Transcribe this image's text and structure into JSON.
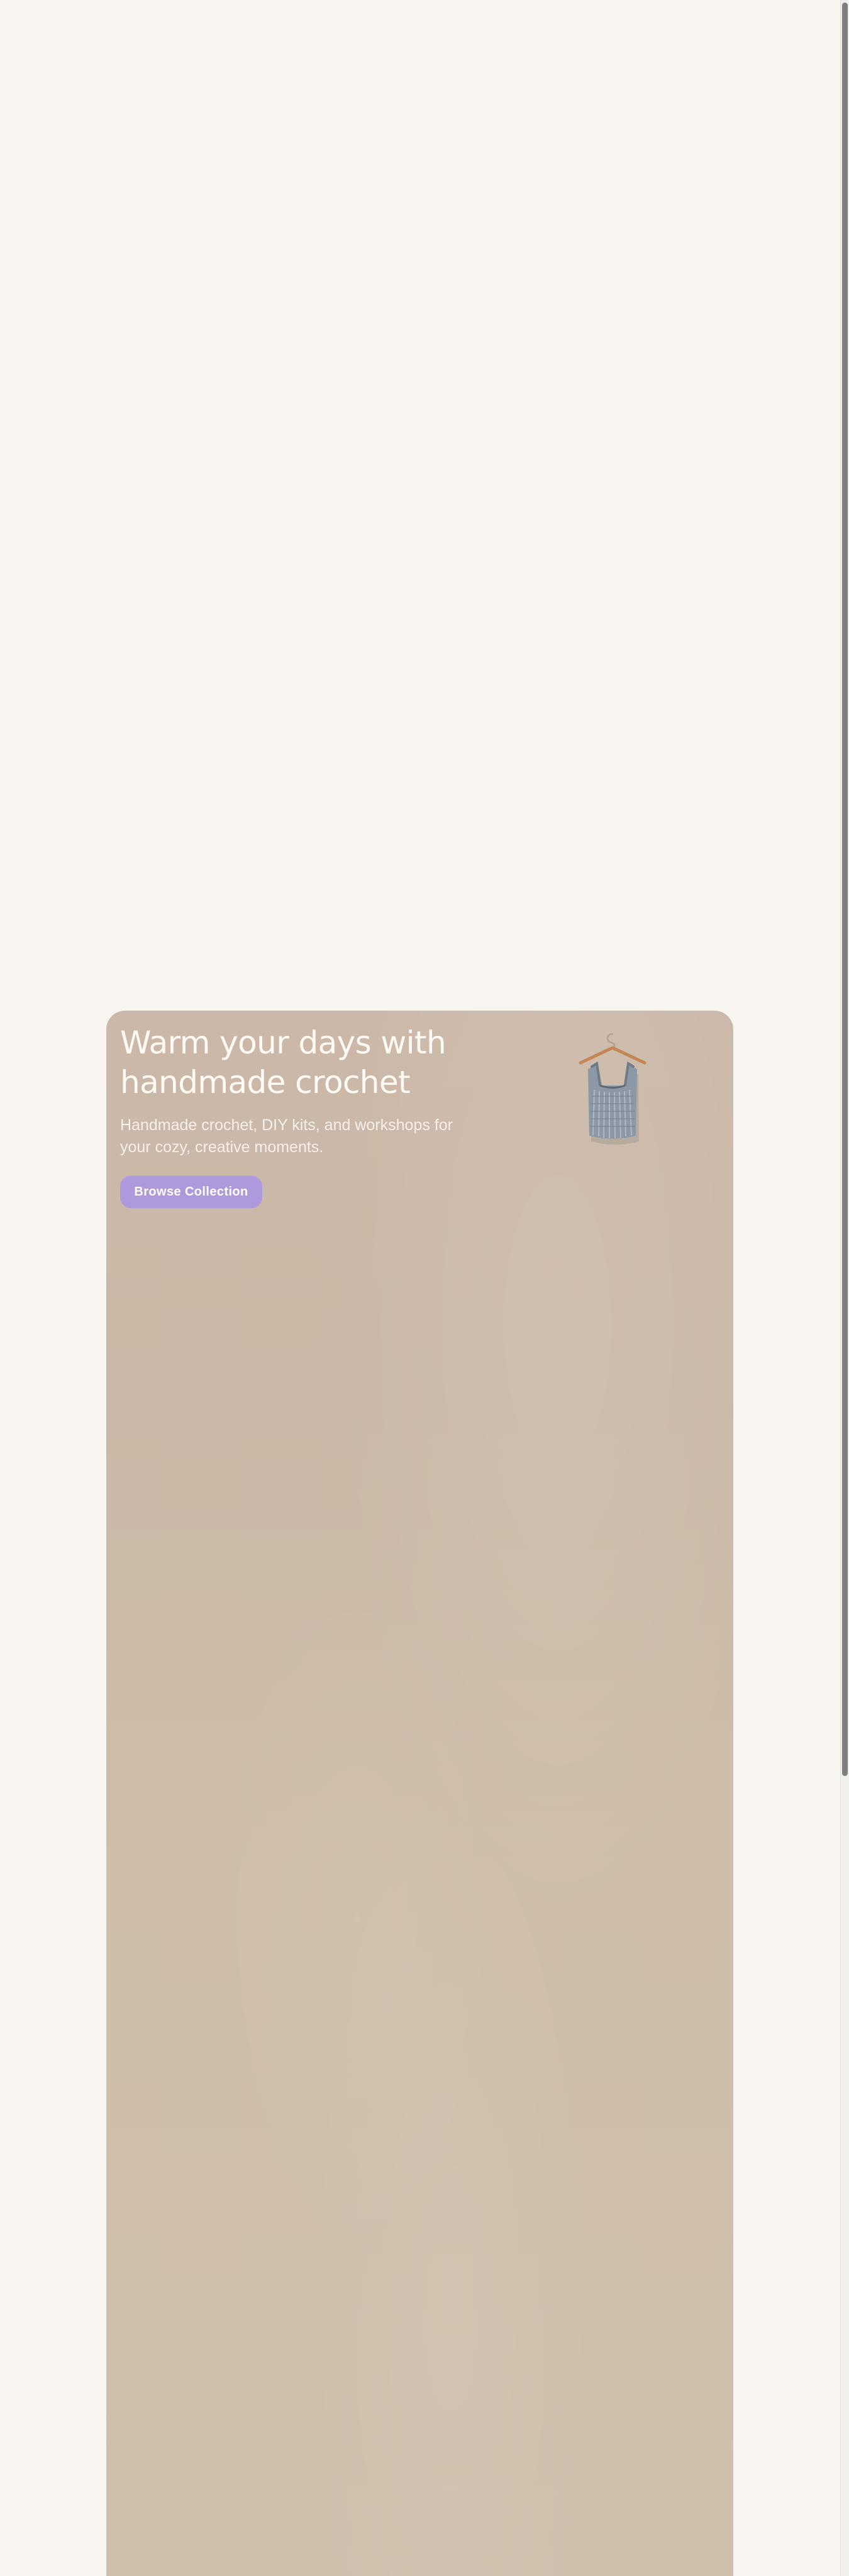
{
  "hero": {
    "title": "Warm your days with handmade crochet",
    "subtitle": "Handmade crochet, DIY kits, and workshops for your cozy, creative moments.",
    "button_label": "Browse Collection",
    "image_label": "crochet top on hanger"
  },
  "colors": {
    "page_background": "#f8f5f0",
    "card_background": "#cbb8a8",
    "button": "#ad99dc",
    "scroll_thumb": "#7f7f7f"
  }
}
